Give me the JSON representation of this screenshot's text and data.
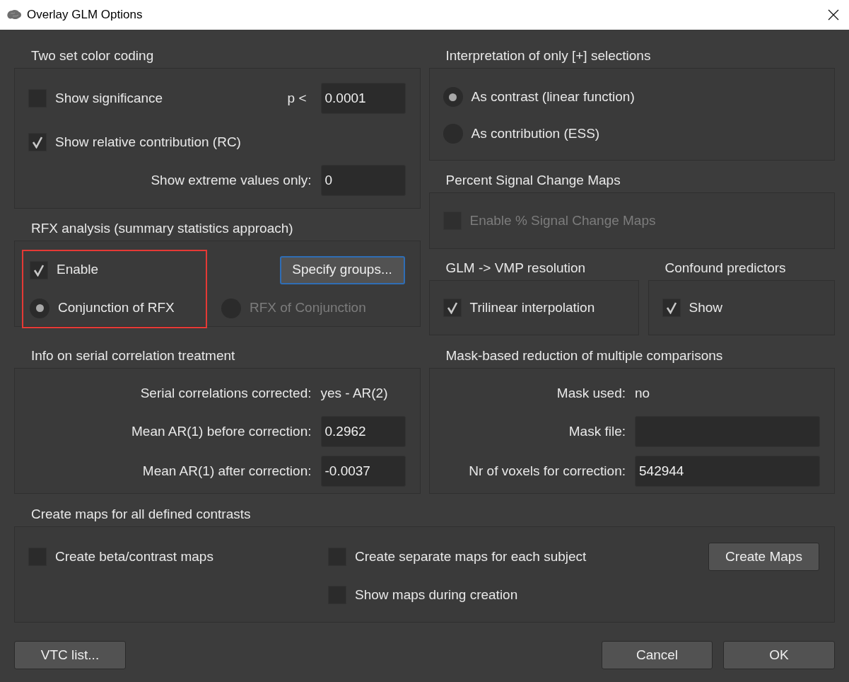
{
  "window": {
    "title": "Overlay GLM Options"
  },
  "color_coding": {
    "title": "Two set color coding",
    "show_significance": {
      "label": "Show significance",
      "checked": false
    },
    "p_label": "p <",
    "p_value": "0.0001",
    "relative_contribution": {
      "label": "Show relative contribution (RC)",
      "checked": true
    },
    "extreme_label": "Show extreme values only:",
    "extreme_value": "0"
  },
  "interpretation": {
    "title": "Interpretation of only [+] selections",
    "options": [
      {
        "label": "As contrast (linear function)",
        "selected": true
      },
      {
        "label": "As contribution (ESS)",
        "selected": false
      }
    ]
  },
  "psc_maps": {
    "title": "Percent Signal Change Maps",
    "enable": {
      "label": "Enable % Signal Change Maps",
      "checked": false,
      "disabled": true
    }
  },
  "rfx": {
    "title": "RFX analysis (summary statistics approach)",
    "highlighted": true,
    "enable": {
      "label": "Enable",
      "checked": true
    },
    "specify_button": {
      "label": "Specify groups...",
      "focused": true
    },
    "options": [
      {
        "label": "Conjunction of RFX",
        "selected": true,
        "disabled": false
      },
      {
        "label": "RFX of Conjunction",
        "selected": false,
        "disabled": true
      }
    ]
  },
  "vmp_resolution": {
    "title": "GLM -> VMP resolution",
    "trilinear": {
      "label": "Trilinear interpolation",
      "checked": true
    }
  },
  "confound": {
    "title": "Confound predictors",
    "show": {
      "label": "Show",
      "checked": true
    }
  },
  "serial_correlation": {
    "title": "Info on serial correlation treatment",
    "rows": [
      {
        "kind": "text",
        "label": "Serial correlations corrected:",
        "value": "yes - AR(2)"
      },
      {
        "kind": "field",
        "label": "Mean AR(1) before correction:",
        "value": "0.2962"
      },
      {
        "kind": "field",
        "label": "Mean AR(1) after correction:",
        "value": "-0.0037"
      }
    ]
  },
  "mask": {
    "title": "Mask-based reduction of multiple comparisons",
    "rows": [
      {
        "kind": "text",
        "label": "Mask used:",
        "value": "no"
      },
      {
        "kind": "field",
        "label": "Mask file:"
      },
      {
        "kind": "field",
        "label": "Nr of voxels for correction:",
        "value": "542944"
      }
    ]
  },
  "create_maps": {
    "title": "Create maps for all defined contrasts",
    "beta_maps": {
      "label": "Create beta/contrast maps",
      "checked": false
    },
    "separate_maps": {
      "label": "Create separate maps for each subject",
      "checked": false
    },
    "show_during": {
      "label": "Show maps during creation",
      "checked": false
    },
    "button": "Create Maps"
  },
  "footer": {
    "vtc_button": "VTC list...",
    "cancel_button": "Cancel",
    "ok_button": "OK"
  }
}
